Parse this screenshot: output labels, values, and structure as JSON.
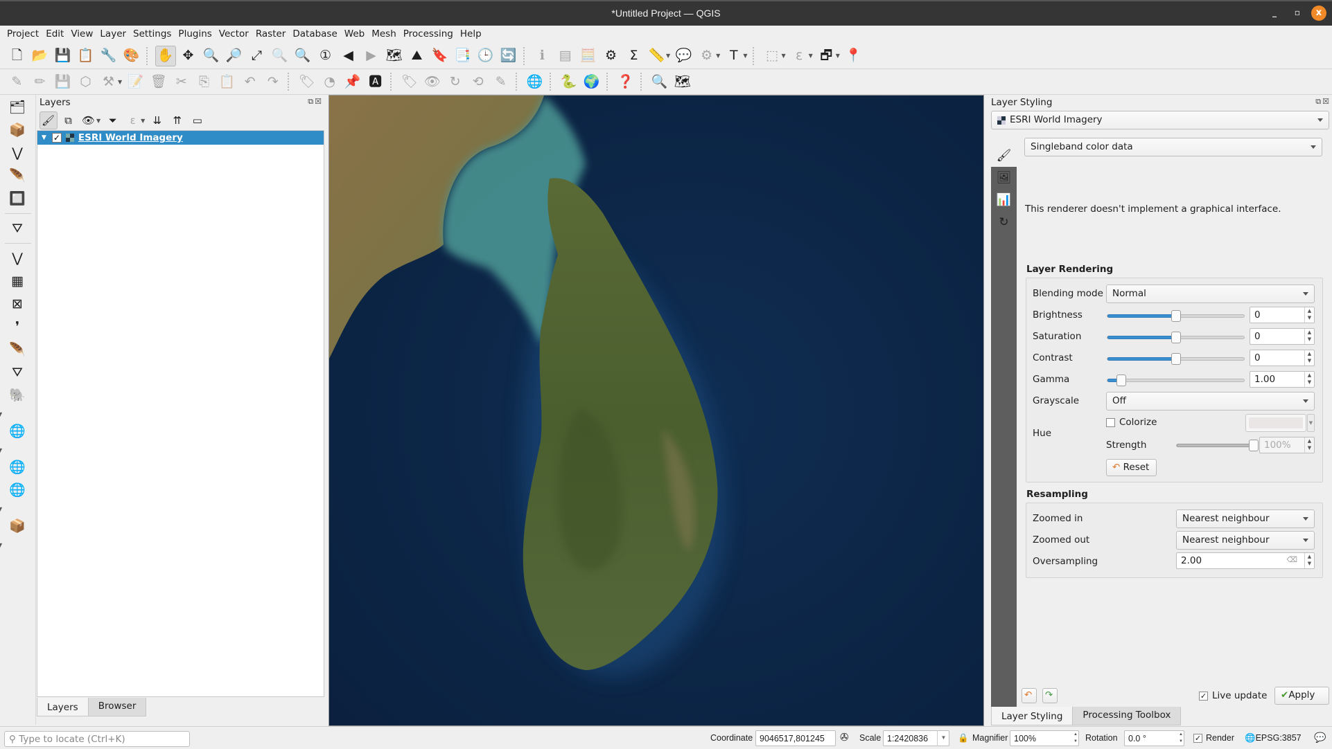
{
  "window": {
    "title": "*Untitled Project — QGIS",
    "controls": {
      "minimize": "_",
      "maximize": "▫",
      "close": "x"
    }
  },
  "menubar": [
    "Project",
    "Edit",
    "View",
    "Layer",
    "Settings",
    "Plugins",
    "Vector",
    "Raster",
    "Database",
    "Web",
    "Mesh",
    "Processing",
    "Help"
  ],
  "toolbar1": [
    {
      "name": "new-project-icon",
      "glyph": "🗋"
    },
    {
      "name": "open-project-icon",
      "glyph": "📂"
    },
    {
      "name": "save-project-icon",
      "glyph": "💾"
    },
    {
      "name": "new-print-layout-icon",
      "glyph": "📋"
    },
    {
      "name": "layout-manager-icon",
      "glyph": "🔧"
    },
    {
      "name": "style-manager-icon",
      "glyph": "🎨"
    },
    {
      "sep": true
    },
    {
      "name": "pan-map-icon",
      "glyph": "✋",
      "active": true
    },
    {
      "name": "pan-to-selection-icon",
      "glyph": "✥"
    },
    {
      "name": "zoom-in-icon",
      "glyph": "🔍"
    },
    {
      "name": "zoom-out-icon",
      "glyph": "🔎"
    },
    {
      "name": "zoom-full-icon",
      "glyph": "⤢"
    },
    {
      "name": "zoom-to-selection-icon",
      "glyph": "🔍",
      "disabled": true
    },
    {
      "name": "zoom-to-layer-icon",
      "glyph": "🔍"
    },
    {
      "name": "zoom-native-resolution-icon",
      "glyph": "①"
    },
    {
      "name": "zoom-last-icon",
      "glyph": "◀"
    },
    {
      "name": "zoom-next-icon",
      "glyph": "▶",
      "disabled": true
    },
    {
      "name": "new-map-view-icon",
      "glyph": "🗺"
    },
    {
      "name": "new-3d-map-view-icon",
      "glyph": "⛰"
    },
    {
      "name": "new-spatial-bookmark-icon",
      "glyph": "🔖"
    },
    {
      "name": "show-bookmarks-icon",
      "glyph": "📑"
    },
    {
      "name": "temporal-controller-icon",
      "glyph": "🕒"
    },
    {
      "name": "refresh-icon",
      "glyph": "🔄"
    },
    {
      "sep": true
    },
    {
      "name": "identify-features-icon",
      "glyph": "ℹ",
      "disabled": true
    },
    {
      "name": "open-attribute-table-icon",
      "glyph": "▤",
      "disabled": true
    },
    {
      "name": "field-calculator-icon",
      "glyph": "🧮",
      "disabled": true
    },
    {
      "name": "processing-toolbox-icon",
      "glyph": "⚙"
    },
    {
      "name": "statistical-summary-icon",
      "glyph": "Σ"
    },
    {
      "name": "measure-line-icon",
      "glyph": "📏",
      "dropdown": true
    },
    {
      "name": "map-tips-icon",
      "glyph": "💬"
    },
    {
      "name": "run-feature-action-icon",
      "glyph": "⚙",
      "disabled": true,
      "dropdown": true
    },
    {
      "name": "text-annotation-icon",
      "glyph": "T",
      "dropdown": true
    },
    {
      "sep": true
    },
    {
      "name": "select-features-icon",
      "glyph": "⬚",
      "disabled": true,
      "dropdown": true
    },
    {
      "name": "select-by-expression-icon",
      "glyph": "ε",
      "disabled": true,
      "dropdown": true
    },
    {
      "name": "deselect-all-icon",
      "glyph": "🗗",
      "dropdown": true
    },
    {
      "name": "show-map-tips-icon",
      "glyph": "📍"
    }
  ],
  "toolbar2": [
    {
      "name": "current-edits-icon",
      "glyph": "✎",
      "disabled": true
    },
    {
      "name": "toggle-editing-icon",
      "glyph": "✏",
      "disabled": true
    },
    {
      "name": "save-layer-edits-icon",
      "glyph": "💾",
      "disabled": true
    },
    {
      "name": "digitize-with-segment-icon",
      "glyph": "⬡",
      "disabled": true
    },
    {
      "name": "vertex-tool-icon",
      "glyph": "⚒",
      "disabled": true,
      "dropdown": true
    },
    {
      "name": "modify-attributes-icon",
      "glyph": "📝",
      "disabled": true
    },
    {
      "name": "delete-selected-icon",
      "glyph": "🗑",
      "disabled": true
    },
    {
      "name": "cut-features-icon",
      "glyph": "✂",
      "disabled": true
    },
    {
      "name": "copy-features-icon",
      "glyph": "⎘",
      "disabled": true
    },
    {
      "name": "paste-features-icon",
      "glyph": "📋",
      "disabled": true
    },
    {
      "name": "undo-icon",
      "glyph": "↶",
      "disabled": true
    },
    {
      "name": "redo-icon",
      "glyph": "↷",
      "disabled": true
    },
    {
      "sep": true
    },
    {
      "name": "label-toolbar-icon",
      "glyph": "🏷",
      "disabled": true
    },
    {
      "name": "layer-diagram-icon",
      "glyph": "◔",
      "disabled": true
    },
    {
      "name": "pin-labels-icon",
      "glyph": "📌"
    },
    {
      "name": "highlight-pinned-labels-icon",
      "glyph": "🅰"
    },
    {
      "sep": true
    },
    {
      "name": "move-label-icon",
      "glyph": "🏷",
      "disabled": true
    },
    {
      "name": "show-hide-labels-icon",
      "glyph": "👁",
      "disabled": true
    },
    {
      "name": "rotate-label-icon",
      "glyph": "↻",
      "disabled": true
    },
    {
      "name": "change-label-icon",
      "glyph": "⟲",
      "disabled": true
    },
    {
      "name": "label-properties-icon",
      "glyph": "✎",
      "disabled": true
    },
    {
      "sep": true
    },
    {
      "name": "metasearch-icon",
      "glyph": "🌐"
    },
    {
      "sep": true
    },
    {
      "name": "python-console-icon",
      "glyph": "🐍"
    },
    {
      "name": "earth-engine-icon",
      "glyph": "🌍"
    },
    {
      "sep": true
    },
    {
      "name": "help-contents-icon",
      "glyph": "❓"
    },
    {
      "sep": true
    },
    {
      "name": "quick-map-services-search-icon",
      "glyph": "🔍"
    },
    {
      "name": "quickmapservices-icon",
      "glyph": "🗺"
    }
  ],
  "left_toolbar": [
    {
      "name": "data-source-manager-icon",
      "glyph": "🗂"
    },
    {
      "name": "new-geopackage-layer-icon",
      "glyph": "📦"
    },
    {
      "name": "new-shapefile-layer-icon",
      "glyph": "⋁"
    },
    {
      "name": "new-temporary-scratch-layer-icon",
      "glyph": "🪶"
    },
    {
      "name": "new-virtual-layer-icon",
      "glyph": "🔲"
    },
    {
      "hsep": true
    },
    {
      "name": "new-spatialite-layer-icon",
      "glyph": "⛛"
    },
    {
      "hsep": true
    },
    {
      "name": "add-vector-layer-icon",
      "glyph": "⋁"
    },
    {
      "name": "add-raster-layer-icon",
      "glyph": "▦"
    },
    {
      "name": "add-mesh-layer-icon",
      "glyph": "⊠"
    },
    {
      "name": "add-delimited-text-layer-icon",
      "glyph": "❜"
    },
    {
      "name": "add-spatialite-layer-icon",
      "glyph": "🪶"
    },
    {
      "name": "add-virtual-layer-icon",
      "glyph": "⛛"
    },
    {
      "name": "add-postgis-layer-icon",
      "glyph": "🐘",
      "dropdown": true
    },
    {
      "name": "add-wms-layer-icon",
      "glyph": "🌐",
      "dropdown": true
    },
    {
      "name": "add-wcs-layer-icon",
      "glyph": "🌐"
    },
    {
      "name": "add-wfs-layer-icon",
      "glyph": "🌐",
      "dropdown": true
    },
    {
      "name": "add-xyz-layer-icon",
      "glyph": "📦",
      "dropdown": true
    }
  ],
  "layers_panel": {
    "title": "Layers",
    "toolbar": [
      {
        "name": "open-layer-styling-icon",
        "glyph": "🖌",
        "active": true
      },
      {
        "name": "add-group-icon",
        "glyph": "⧉"
      },
      {
        "name": "manage-map-themes-icon",
        "glyph": "👁",
        "dropdown": true
      },
      {
        "name": "filter-legend-icon",
        "glyph": "⏷"
      },
      {
        "name": "filter-by-expression-icon",
        "glyph": "ε",
        "disabled": true,
        "dropdown": true
      },
      {
        "name": "expand-all-icon",
        "glyph": "⇊"
      },
      {
        "name": "collapse-all-icon",
        "glyph": "⇈"
      },
      {
        "name": "remove-layer-icon",
        "glyph": "▭"
      }
    ],
    "layers": [
      {
        "name": "ESRI World Imagery",
        "checked": true,
        "selected": true
      }
    ]
  },
  "left_tabs": [
    {
      "label": "Layers",
      "active": true
    },
    {
      "label": "Browser",
      "active": false
    }
  ],
  "styling_panel": {
    "title": "Layer Styling",
    "layer_combo": "ESRI World Imagery",
    "renderer_combo": "Singleband color data",
    "message": "This renderer doesn't implement a graphical interface.",
    "layer_rendering": {
      "title": "Layer Rendering",
      "blending_mode_label": "Blending mode",
      "blending_mode": "Normal",
      "brightness_label": "Brightness",
      "brightness": "0",
      "brightness_fraction": 0.5,
      "saturation_label": "Saturation",
      "saturation": "0",
      "saturation_fraction": 0.5,
      "contrast_label": "Contrast",
      "contrast": "0",
      "contrast_fraction": 0.5,
      "gamma_label": "Gamma",
      "gamma": "1.00",
      "gamma_fraction": 0.1,
      "grayscale_label": "Grayscale",
      "grayscale": "Off",
      "hue_label": "Hue",
      "colorize_label": "Colorize",
      "colorize_checked": false,
      "strength_label": "Strength",
      "strength": "100%",
      "strength_fraction": 1.0,
      "reset_label": "Reset"
    },
    "resampling": {
      "title": "Resampling",
      "zoomed_in_label": "Zoomed in",
      "zoomed_in": "Nearest neighbour",
      "zoomed_out_label": "Zoomed out",
      "zoomed_out": "Nearest neighbour",
      "oversampling_label": "Oversampling",
      "oversampling": "2.00"
    },
    "live_update_label": "Live update",
    "live_update_checked": true,
    "apply_label": "Apply"
  },
  "right_tabs": [
    {
      "label": "Layer Styling",
      "active": true
    },
    {
      "label": "Processing Toolbox",
      "active": false
    }
  ],
  "statusbar": {
    "locator_placeholder": "Type to locate (Ctrl+K)",
    "coordinate_label": "Coordinate",
    "coordinate": "9046517,801245",
    "scale_label": "Scale",
    "scale": "1:2420836",
    "magnifier_label": "Magnifier",
    "magnifier": "100%",
    "rotation_label": "Rotation",
    "rotation": "0.0 °",
    "render_label": "Render",
    "render_checked": true,
    "crs": "EPSG:3857"
  },
  "colors": {
    "selection": "#308cc6",
    "slider_fill": "#3a8fd0",
    "ocean": "#0b2240",
    "titlebar": "#353535",
    "close_button": "#f08a28"
  }
}
